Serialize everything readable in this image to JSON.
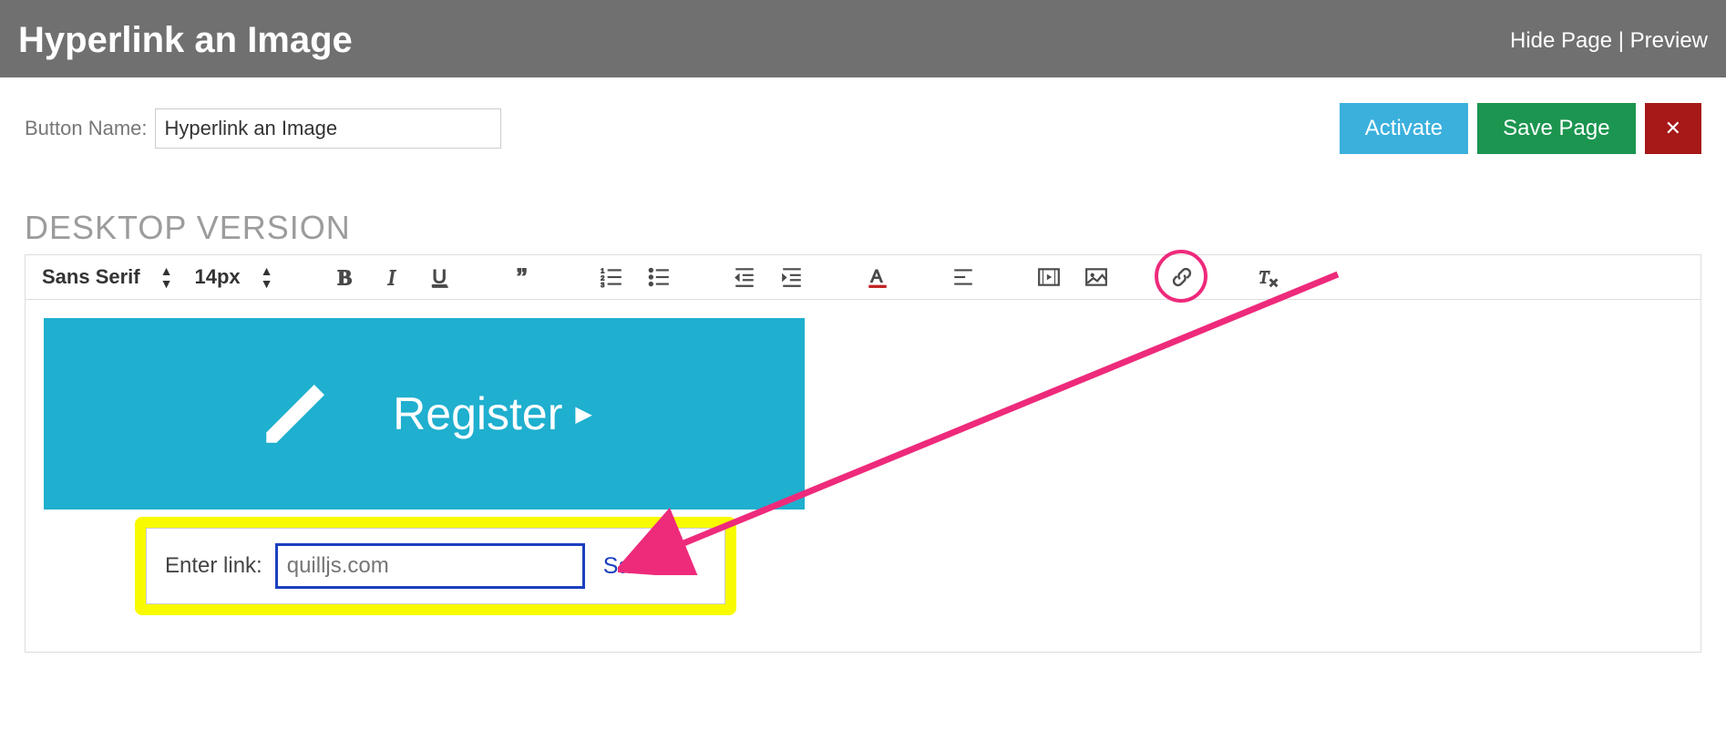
{
  "header": {
    "title": "Hyperlink an Image",
    "hide_page": "Hide Page",
    "preview": "Preview",
    "separator": "|"
  },
  "button_name": {
    "label": "Button Name:",
    "value": "Hyperlink an Image"
  },
  "actions": {
    "activate": "Activate",
    "save_page": "Save Page",
    "close": "✕"
  },
  "section_title": "DESKTOP VERSION",
  "toolbar": {
    "font_select": "Sans Serif",
    "size_select": "14px"
  },
  "content": {
    "register_label": "Register"
  },
  "link_popup": {
    "label": "Enter link:",
    "placeholder": "quilljs.com",
    "value": "",
    "save": "Save"
  },
  "colors": {
    "accent_pink": "#ee2a7b",
    "highlight_yellow": "#f8fb00",
    "teal": "#1fafcf"
  }
}
